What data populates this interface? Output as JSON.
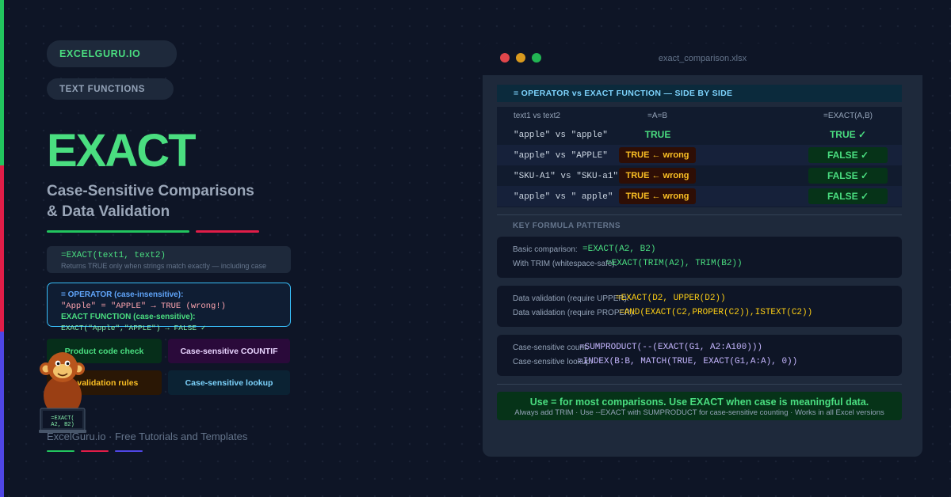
{
  "brand": {
    "name": "EXCELGURU.IO",
    "category": "TEXT FUNCTIONS"
  },
  "hero": {
    "title": "EXACT",
    "subtitle_line1": "Case-Sensitive Comparisons",
    "subtitle_line2": "& Data Validation"
  },
  "syntax": {
    "code": "=EXACT(text1, text2)",
    "note": "Returns TRUE only when strings match exactly — including case"
  },
  "comparison": {
    "operator_heading": "= OPERATOR (case-insensitive):",
    "operator_example": "\"Apple\" = \"APPLE\" → TRUE (wrong!)",
    "exact_heading": "EXACT FUNCTION (case-sensitive):",
    "exact_example": "EXACT(\"Apple\",\"APPLE\") → FALSE ✓"
  },
  "use_cases": [
    "Product code check",
    "Case-sensitive COUNTIF",
    "a validation rules",
    "Case-sensitive lookup"
  ],
  "mascot": {
    "screen_line1": "=EXACT(",
    "screen_line2": "A2, B2)"
  },
  "footer": {
    "text": "ExcelGuru.io · Free Tutorials and Templates"
  },
  "window": {
    "filename": "exact_comparison.xlsx",
    "section_header": "= OPERATOR vs EXACT FUNCTION — SIDE BY SIDE",
    "table": {
      "headers": [
        "text1 vs text2",
        "=A=B",
        "=EXACT(A,B)"
      ],
      "rows": [
        {
          "text": "\"apple\" vs \"apple\"",
          "operator": "TRUE",
          "exact": "TRUE ✓"
        },
        {
          "text": "\"apple\" vs \"APPLE\"",
          "operator": "TRUE ← wrong",
          "exact": "FALSE ✓"
        },
        {
          "text": "\"SKU-A1\" vs \"SKU-a1\"",
          "operator": "TRUE ← wrong",
          "exact": "FALSE ✓"
        },
        {
          "text": "\"apple\" vs \" apple\"",
          "operator": "TRUE ← wrong",
          "exact": "FALSE ✓"
        }
      ]
    },
    "patterns_title": "KEY FORMULA PATTERNS",
    "patterns": [
      {
        "label": "Basic comparison:",
        "code": "=EXACT(A2, B2)"
      },
      {
        "label": "With TRIM (whitespace-safe):",
        "code": "=EXACT(TRIM(A2), TRIM(B2))"
      },
      {
        "label": "Data validation (require UPPER):",
        "code": "=EXACT(D2, UPPER(D2))"
      },
      {
        "label": "Data validation (require PROPER):",
        "code": "=AND(EXACT(C2,PROPER(C2)),ISTEXT(C2))"
      },
      {
        "label": "Case-sensitive count:",
        "code": "=SUMPRODUCT(--(EXACT(G1, A2:A100)))"
      },
      {
        "label": "Case-sensitive lookup:",
        "code": "=INDEX(B:B, MATCH(TRUE, EXACT(G1,A:A), 0))"
      }
    ],
    "summary_main": "Use = for most comparisons. Use EXACT when case is meaningful data.",
    "summary_sub": "Always add TRIM · Use --EXACT with SUMPRODUCT for case-sensitive counting · Works in all Excel versions"
  },
  "colors": {
    "background": "#0e1526",
    "accent_green": "#22c55e",
    "accent_red": "#e11d48",
    "accent_blue": "#4f46e5"
  }
}
